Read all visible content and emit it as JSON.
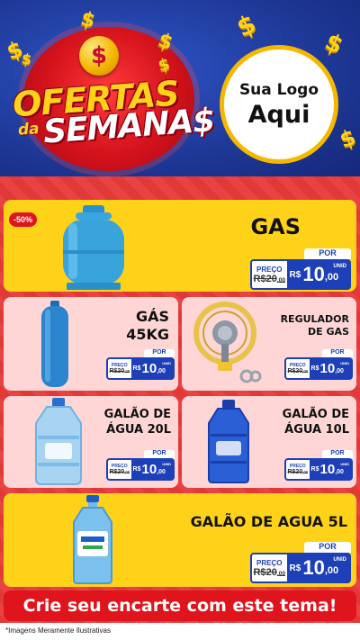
{
  "header": {
    "title_line1": "OFERTAS",
    "title_small": "da",
    "title_line2": "SEMANA$",
    "coin_symbol": "$",
    "logo_line1": "Sua Logo",
    "logo_line2": "Aqui"
  },
  "colors": {
    "brand_blue": "#1d3fb8",
    "brand_red": "#e0141c",
    "accent_yellow": "#ffd21a",
    "card_pink": "#ffd6d6"
  },
  "price_labels": {
    "por": "POR",
    "preco": "PREÇO",
    "currency": "R$",
    "unit": "UNID",
    "old_price": "20",
    "old_cents": "00",
    "price": "10",
    "cents": ",00"
  },
  "products": [
    {
      "name": "GAS",
      "badge": "-50%",
      "icon": "gas-cylinder-icon"
    },
    {
      "name_line1": "GÁS",
      "name_line2": "45KG",
      "icon": "tall-gas-cylinder-icon"
    },
    {
      "name_line1": "REGULADOR",
      "name_line2": "DE GAS",
      "icon": "gas-regulator-icon"
    },
    {
      "name_line1": "GALÃO DE",
      "name_line2": "ÁGUA 20L",
      "icon": "water-jug-20l-icon"
    },
    {
      "name_line1": "GALÃO DE",
      "name_line2": "ÁGUA 10L",
      "icon": "water-jug-10l-icon"
    },
    {
      "name": "GALÃO DE AGUA 5L",
      "icon": "water-bottle-5l-icon"
    }
  ],
  "footer": {
    "cta": "Crie seu encarte com este tema!",
    "disclaimer": "*Imagens Meramente Ilustrativas"
  }
}
